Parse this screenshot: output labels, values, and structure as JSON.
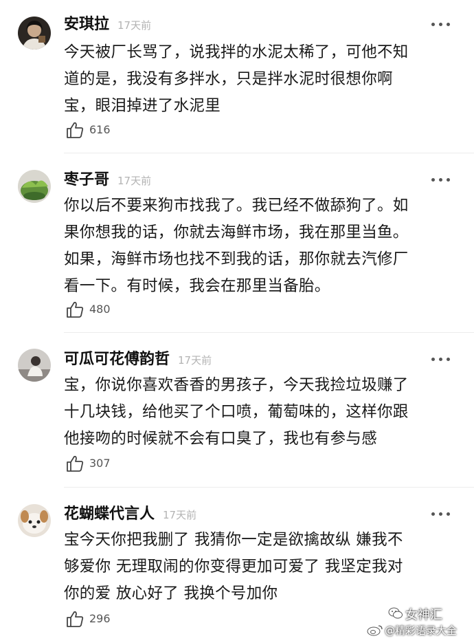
{
  "comments": [
    {
      "author": "安琪拉",
      "time": "17天前",
      "lines": [
        "今天被厂长骂了，说我拌的水泥太稀了，可他不知",
        "道的是，我没有多拌水，只是拌水泥时很想你啊",
        "宝，眼泪掉进了水泥里"
      ],
      "likes": "616",
      "avatar_icon": "dark-portrait-avatar"
    },
    {
      "author": "枣子哥",
      "time": "17天前",
      "lines": [
        "你以后不要来狗市找我了。我已经不做舔狗了。如",
        "果你想我的话，你就去海鲜市场，我在那里当鱼。",
        "如果，海鲜市场也找不到我的话，那你就去汽修厂",
        "看一下。有时候，我会在那里当备胎。"
      ],
      "likes": "480",
      "avatar_icon": "green-plant-avatar"
    },
    {
      "author": "可瓜可花傅韵哲",
      "time": "17天前",
      "lines": [
        "宝，你说你喜欢香香的男孩子，今天我捡垃圾赚了",
        "十几块钱，给他买了个口喷，葡萄味的，这样你跟",
        "他接吻的时候就不会有口臭了，我也有参与感"
      ],
      "likes": "307",
      "avatar_icon": "person-sitting-avatar"
    },
    {
      "author": "花蝴蝶代言人",
      "time": "17天前",
      "lines": [
        "宝今天你把我删了 我猜你一定是欲擒故纵 嫌我不",
        "够爱你 无理取闹的你变得更加可爱了 我坚定我对",
        "你的爱 放心好了 我换个号加你"
      ],
      "likes": "296",
      "avatar_icon": "puppy-avatar"
    }
  ],
  "watermark": {
    "brand": "女神汇",
    "handle": "@精彩语录大全",
    "brand_icon": "wechat-logo-icon",
    "handle_icon": "weibo-logo-icon"
  }
}
